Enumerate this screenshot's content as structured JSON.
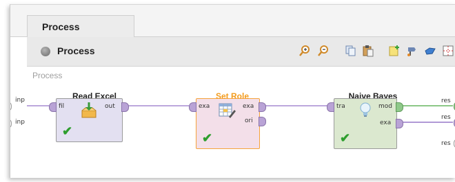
{
  "tab": {
    "label": "Process"
  },
  "toolbar": {
    "process_label": "Process",
    "icons": [
      "zoom-in-icon",
      "zoom-out-icon",
      "copy-icon",
      "paste-icon",
      "add-note-icon",
      "route-icon",
      "auto-wire-icon",
      "grid-icon"
    ]
  },
  "canvas": {
    "title": "Process",
    "left_ports": [
      "inp",
      "inp"
    ],
    "right_ports": [
      "res",
      "res",
      "res"
    ],
    "operators": [
      {
        "name": "Read Excel",
        "in_ports": [
          "fil"
        ],
        "out_ports": [
          "out"
        ],
        "status": "✔"
      },
      {
        "name": "Set Role",
        "in_ports": [
          "exa"
        ],
        "out_ports": [
          "exa",
          "ori"
        ],
        "status": "✔"
      },
      {
        "name": "Naive Bayes",
        "in_ports": [
          "tra"
        ],
        "out_ports": [
          "mod",
          "exa"
        ],
        "status": "✔"
      }
    ]
  },
  "colors": {
    "set_role_title": "#f39c1e",
    "set_role_border": "#f5a33a",
    "set_role_bg": "#f3dfe9",
    "read_excel_bg": "#e3e0f1",
    "naive_bayes_bg": "#dbe8cf",
    "wire_purple": "#a58ad0",
    "wire_green": "#7cbf74"
  }
}
